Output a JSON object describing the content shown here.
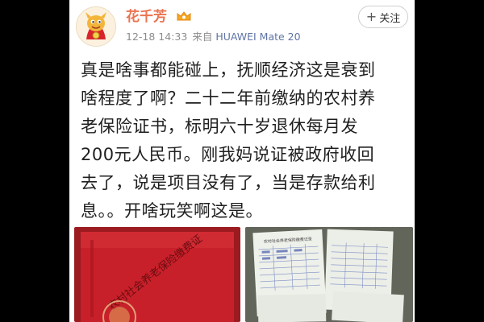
{
  "post": {
    "author_name": "花千芳",
    "timestamp": "12-18 14:33",
    "source_prefix": "来自",
    "device": "HUAWEI Mate 20",
    "follow_label": "关注",
    "follow_plus": "+",
    "text_lines": [
      "真是啥事都能碰上，抚顺经济这是衰到",
      "啥程度了啊？二十二年前缴纳的农村养",
      "老保险证书，标明六十岁退休每月发",
      "200元人民币。刚我妈说证被政府收回",
      "去了，说是项目没有了，当是存款给利",
      "息。。开啥玩笑啊这是。"
    ],
    "images": [
      {
        "icon": "certificate-cover-photo",
        "cover_text": "农村社会养老保险缴费证"
      },
      {
        "icon": "certificate-pages-photo",
        "page_title": "农村社会养老保险缴费记录"
      }
    ]
  },
  "colors": {
    "username": "#eb7350",
    "device": "#5f74a6",
    "meta": "#8c8c8c",
    "cover_red": "#c8202a"
  }
}
